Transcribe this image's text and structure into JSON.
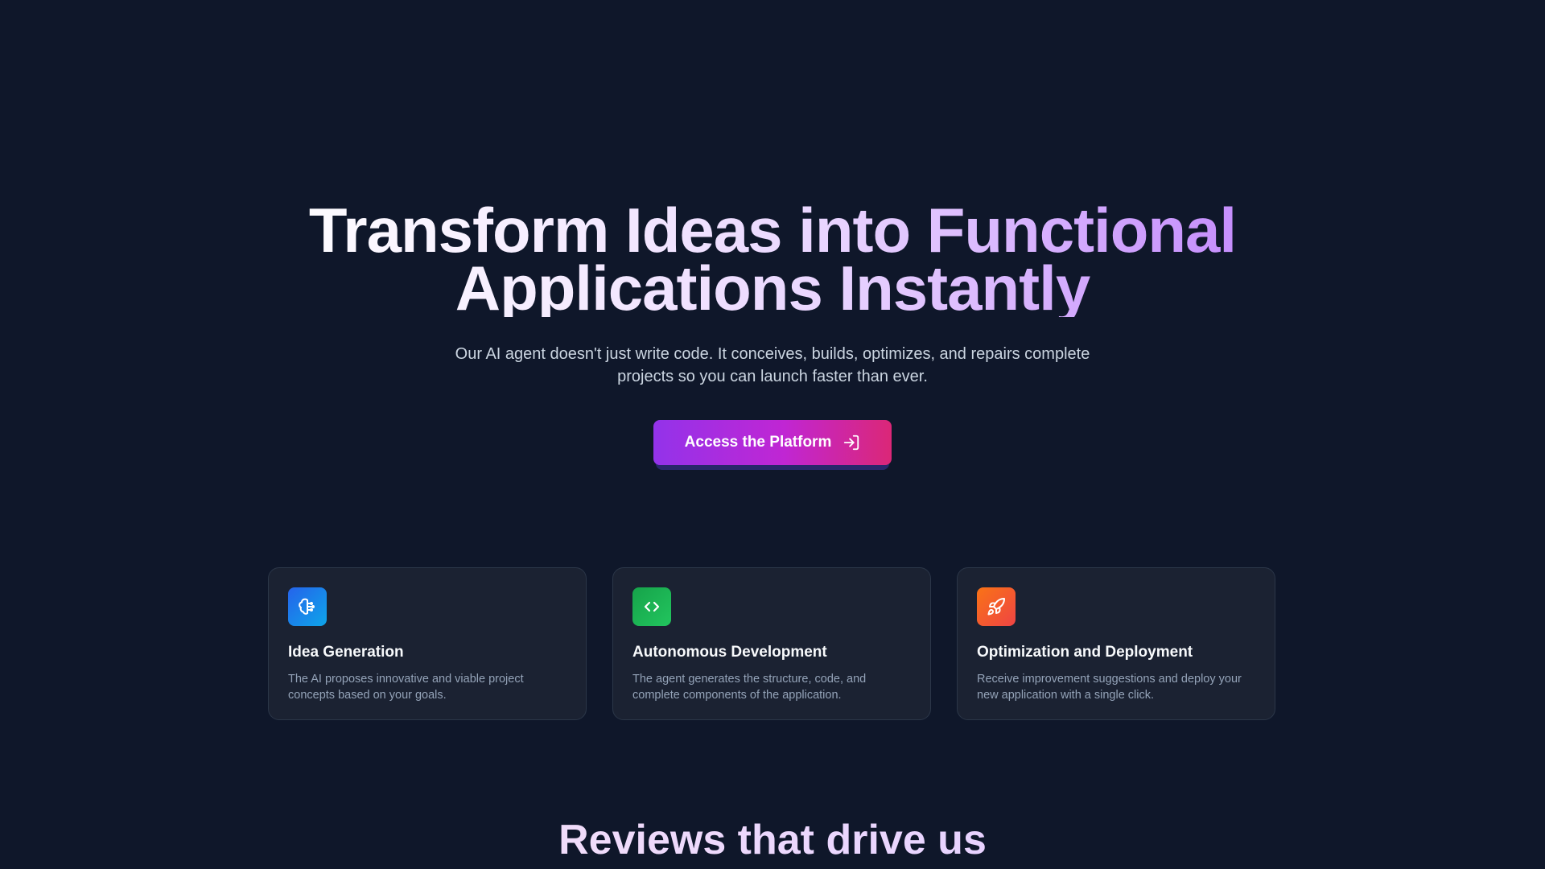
{
  "hero": {
    "title_line1": "Transform Ideas into Functional",
    "title_line2": "Applications Instantly",
    "subtitle": "Our AI agent doesn't just write code. It conceives, builds, optimizes, and repairs complete projects so you can launch faster than ever.",
    "cta_label": "Access the Platform",
    "cta_icon": "login-arrow-icon"
  },
  "features": [
    {
      "icon": "brain-idea-icon",
      "icon_color": "#1d9bf0",
      "title": "Idea Generation",
      "description": "The AI proposes innovative and viable project concepts based on your goals."
    },
    {
      "icon": "code-brackets-icon",
      "icon_color": "#22c55e",
      "title": "Autonomous Development",
      "description": "The agent generates the structure, code, and complete components of the application."
    },
    {
      "icon": "rocket-icon",
      "icon_color": "#f97316",
      "title": "Optimization and Deployment",
      "description": "Receive improvement suggestions and deploy your new application with a single click."
    }
  ],
  "reviews": {
    "title": "Reviews that drive us"
  },
  "colors": {
    "background": "#0f172a",
    "card_background": "#1b2232",
    "accent_start": "#9333ea",
    "accent_end": "#db2777"
  }
}
